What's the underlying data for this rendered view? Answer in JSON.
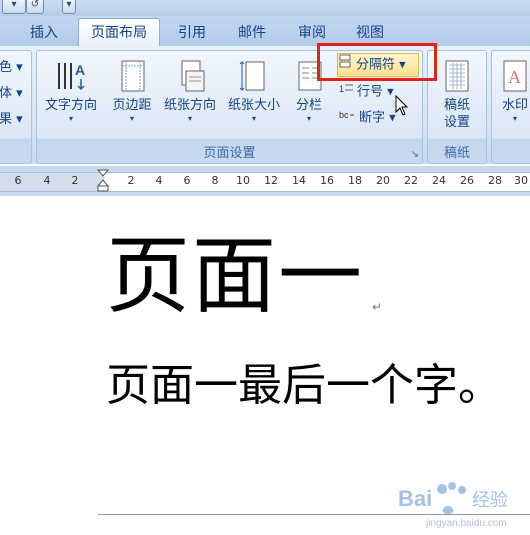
{
  "quick_access": {
    "undo_glyph": "↺"
  },
  "tabs": [
    {
      "label": "插入"
    },
    {
      "label": "页面布局"
    },
    {
      "label": "引用"
    },
    {
      "label": "邮件"
    },
    {
      "label": "审阅"
    },
    {
      "label": "视图"
    }
  ],
  "ribbon": {
    "theme_partial": [
      {
        "label": "色 ▾"
      },
      {
        "label": "体 ▾"
      },
      {
        "label": "果 ▾"
      }
    ],
    "page_setup": {
      "group_label": "页面设置",
      "buttons": [
        {
          "label": "文字方向"
        },
        {
          "label": "页边距"
        },
        {
          "label": "纸张方向"
        },
        {
          "label": "纸张大小"
        },
        {
          "label": "分栏"
        }
      ],
      "small_buttons": [
        {
          "label": "分隔符 ▾"
        },
        {
          "label": "行号 ▾"
        },
        {
          "label": "断字 ▾"
        }
      ],
      "dialog_launcher_glyph": "↘"
    },
    "manuscript": {
      "group_label": "稿纸",
      "button_line1": "稿纸",
      "button_line2": "设置"
    },
    "watermark_partial": {
      "label": "水印"
    }
  },
  "ruler": {
    "ticks": [
      "6",
      "4",
      "2",
      "2",
      "4",
      "6",
      "8",
      "10",
      "12",
      "14",
      "16",
      "18",
      "20",
      "22",
      "24",
      "26",
      "28",
      "30"
    ]
  },
  "document": {
    "heading": "页面一",
    "paragraph": "页面一最后一个字。",
    "paragraph_mark": "↵"
  },
  "watermark_text": {
    "brand_left": "Bai",
    "brand_right": "经验",
    "url": "jingyan.baidu.com"
  },
  "colors": {
    "highlight_box": "#e2231a",
    "tab_text": "#15428b",
    "ribbon_bg": "#dbe7f6"
  }
}
